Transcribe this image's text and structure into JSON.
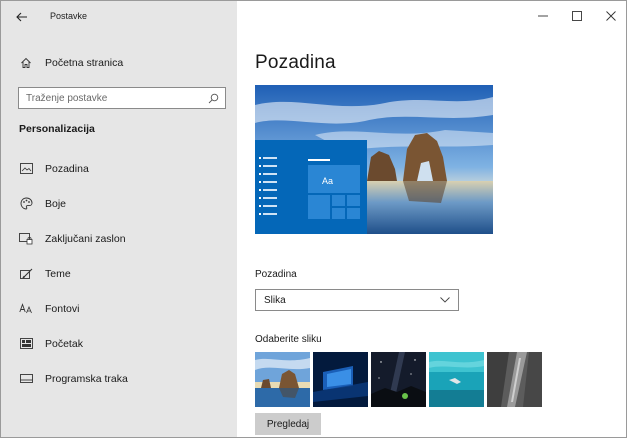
{
  "window": {
    "title": "Postavke",
    "back_icon": "back-arrow-icon",
    "controls": {
      "minimize": "–",
      "maximize": "□",
      "close": "×"
    }
  },
  "sidebar": {
    "home": {
      "label": "Početna stranica",
      "icon": "home-icon"
    },
    "search": {
      "placeholder": "Traženje postavke",
      "icon": "search-icon"
    },
    "section_title": "Personalizacija",
    "items": [
      {
        "label": "Pozadina",
        "icon": "picture-icon"
      },
      {
        "label": "Boje",
        "icon": "palette-icon"
      },
      {
        "label": "Zaključani zaslon",
        "icon": "lock-screen-icon"
      },
      {
        "label": "Teme",
        "icon": "brush-icon"
      },
      {
        "label": "Fontovi",
        "icon": "font-icon"
      },
      {
        "label": "Početak",
        "icon": "start-icon"
      },
      {
        "label": "Programska traka",
        "icon": "taskbar-icon"
      }
    ]
  },
  "main": {
    "title": "Pozadina",
    "preview_tile_text": "Aa",
    "background_label": "Pozadina",
    "background_select": {
      "value": "Slika"
    },
    "choose_label": "Odaberite sliku",
    "thumbnails": [
      {
        "name": "beach-arch"
      },
      {
        "name": "windows-light"
      },
      {
        "name": "night-sky"
      },
      {
        "name": "underwater-swimmer"
      },
      {
        "name": "rock-waterfall"
      }
    ],
    "browse_button": "Pregledaj"
  },
  "colors": {
    "sidebar_bg": "#e6e6e6",
    "accent": "#0063b1",
    "button_bg": "#cccccc"
  }
}
